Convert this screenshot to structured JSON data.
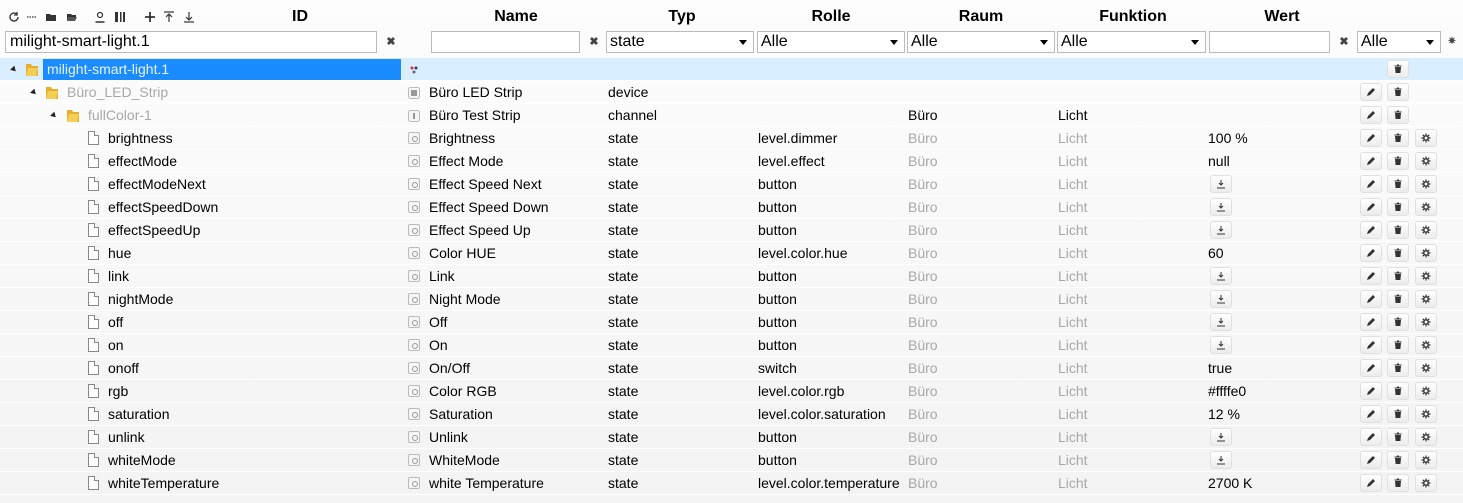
{
  "header": {
    "col_id": "ID",
    "col_name": "Name",
    "col_typ": "Typ",
    "col_rolle": "Rolle",
    "col_raum": "Raum",
    "col_funktion": "Funktion",
    "col_wert": "Wert"
  },
  "toolbar": {
    "icons": [
      "refresh-icon",
      "list-icon",
      "folder-closed-icon",
      "folder-open-icon",
      "user-icon",
      "columns-icon",
      "add-icon",
      "upload-icon",
      "download-icon"
    ]
  },
  "filter": {
    "id_value": "milight-smart-light.1",
    "name_value": "",
    "typ_selected": "state",
    "rolle_selected": "Alle",
    "raum_selected": "Alle",
    "funktion_selected": "Alle",
    "wert_value": "",
    "extra_selected": "Alle"
  },
  "tree": {
    "root": {
      "id": "milight-smart-light.1"
    },
    "device": {
      "id": "Büro_LED_Strip",
      "name": "Büro LED Strip",
      "typ": "device"
    },
    "channel": {
      "id": "fullColor-1",
      "name": "Büro Test Strip",
      "typ": "channel",
      "raum": "Büro",
      "funktion": "Licht"
    },
    "states": [
      {
        "id": "brightness",
        "name": "Brightness",
        "typ": "state",
        "rolle": "level.dimmer",
        "raum": "Büro",
        "funktion": "Licht",
        "wert": "100 %",
        "button": false
      },
      {
        "id": "effectMode",
        "name": "Effect Mode",
        "typ": "state",
        "rolle": "level.effect",
        "raum": "Büro",
        "funktion": "Licht",
        "wert": "null",
        "button": false
      },
      {
        "id": "effectModeNext",
        "name": "Effect Speed Next",
        "typ": "state",
        "rolle": "button",
        "raum": "Büro",
        "funktion": "Licht",
        "wert": "",
        "button": true
      },
      {
        "id": "effectSpeedDown",
        "name": "Effect Speed Down",
        "typ": "state",
        "rolle": "button",
        "raum": "Büro",
        "funktion": "Licht",
        "wert": "",
        "button": true
      },
      {
        "id": "effectSpeedUp",
        "name": "Effect Speed Up",
        "typ": "state",
        "rolle": "button",
        "raum": "Büro",
        "funktion": "Licht",
        "wert": "",
        "button": true
      },
      {
        "id": "hue",
        "name": "Color HUE",
        "typ": "state",
        "rolle": "level.color.hue",
        "raum": "Büro",
        "funktion": "Licht",
        "wert": "60",
        "button": false
      },
      {
        "id": "link",
        "name": "Link",
        "typ": "state",
        "rolle": "button",
        "raum": "Büro",
        "funktion": "Licht",
        "wert": "",
        "button": true
      },
      {
        "id": "nightMode",
        "name": "Night Mode",
        "typ": "state",
        "rolle": "button",
        "raum": "Büro",
        "funktion": "Licht",
        "wert": "",
        "button": true
      },
      {
        "id": "off",
        "name": "Off",
        "typ": "state",
        "rolle": "button",
        "raum": "Büro",
        "funktion": "Licht",
        "wert": "",
        "button": true
      },
      {
        "id": "on",
        "name": "On",
        "typ": "state",
        "rolle": "button",
        "raum": "Büro",
        "funktion": "Licht",
        "wert": "",
        "button": true
      },
      {
        "id": "onoff",
        "name": "On/Off",
        "typ": "state",
        "rolle": "switch",
        "raum": "Büro",
        "funktion": "Licht",
        "wert": "true",
        "button": false
      },
      {
        "id": "rgb",
        "name": "Color RGB",
        "typ": "state",
        "rolle": "level.color.rgb",
        "raum": "Büro",
        "funktion": "Licht",
        "wert": "#ffffe0",
        "button": false
      },
      {
        "id": "saturation",
        "name": "Saturation",
        "typ": "state",
        "rolle": "level.color.saturation",
        "raum": "Büro",
        "funktion": "Licht",
        "wert": "12 %",
        "button": false
      },
      {
        "id": "unlink",
        "name": "Unlink",
        "typ": "state",
        "rolle": "button",
        "raum": "Büro",
        "funktion": "Licht",
        "wert": "",
        "button": true
      },
      {
        "id": "whiteMode",
        "name": "WhiteMode",
        "typ": "state",
        "rolle": "button",
        "raum": "Büro",
        "funktion": "Licht",
        "wert": "",
        "button": true
      },
      {
        "id": "whiteTemperature",
        "name": "white Temperature",
        "typ": "state",
        "rolle": "level.color.temperature",
        "raum": "Büro",
        "funktion": "Licht",
        "wert": "2700 K",
        "button": false
      }
    ]
  },
  "colors": {
    "selection": "#1a8cff",
    "selected_row": "#d9efff",
    "folder": "#f0c23c",
    "muted_text": "#a8a8a8"
  }
}
